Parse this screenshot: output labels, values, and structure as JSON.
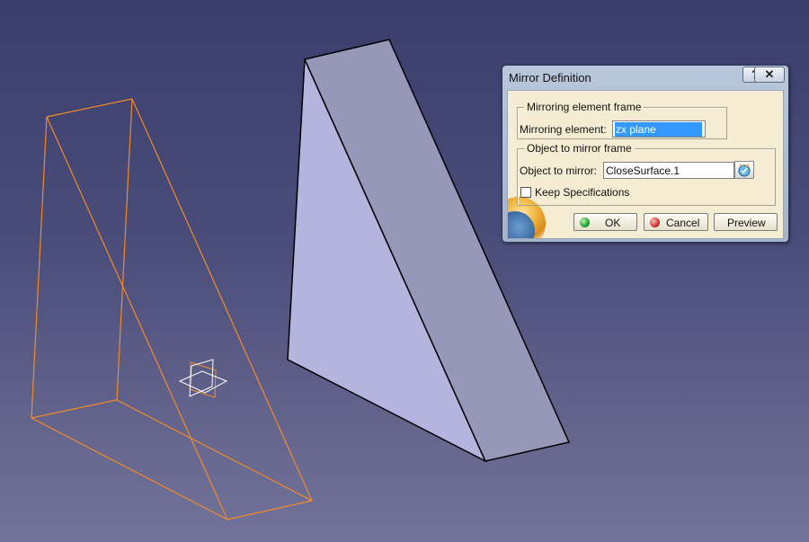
{
  "dialog": {
    "title": "Mirror Definition",
    "help_button": "?",
    "close_button": "✕",
    "mirroring_frame": {
      "legend": "Mirroring element frame",
      "label": "Mirroring element:",
      "value": "zx plane"
    },
    "object_frame": {
      "legend": "Object to mirror frame",
      "label": "Object to mirror:",
      "value": "CloseSurface.1"
    },
    "keep_specifications": {
      "label": "Keep Specifications",
      "checked": false
    },
    "buttons": {
      "ok": "OK",
      "cancel": "Cancel",
      "preview": "Preview"
    }
  },
  "colors": {
    "background_top": "#3b3e6c",
    "background_bottom": "#72739a",
    "solid_face_light": "#b3b4de",
    "solid_face_dark": "#9696b8",
    "wireframe": "#f28a2a",
    "selection": "#3399ff",
    "ok_dot": "#1fa12f",
    "cancel_dot": "#d23232"
  }
}
